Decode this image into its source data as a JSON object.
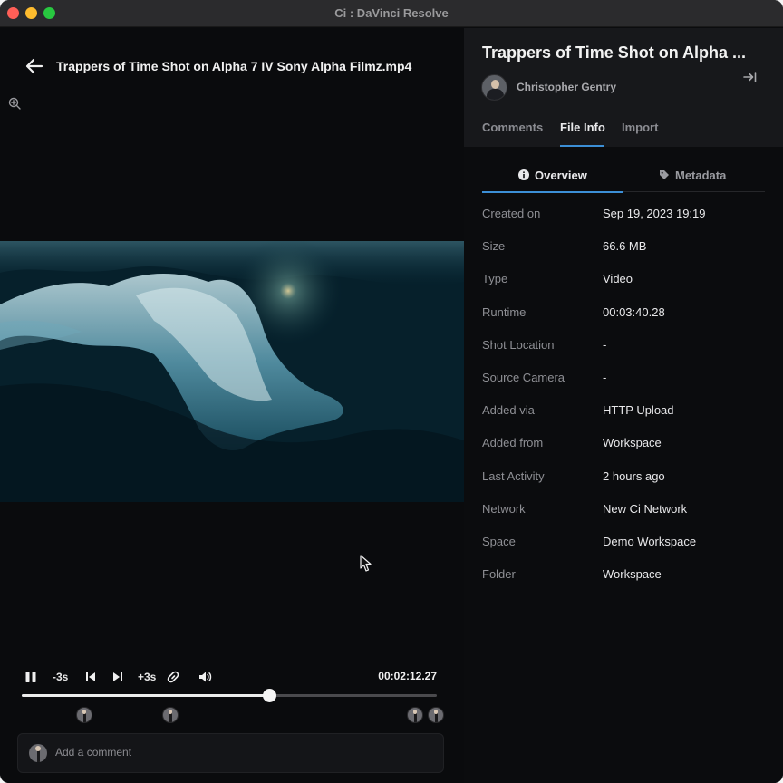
{
  "window": {
    "title": "Ci : DaVinci Resolve"
  },
  "player": {
    "file_title": "Trappers of Time Shot on Alpha 7 IV Sony Alpha Filmz.mp4",
    "controls": {
      "rewind_label": "-3s",
      "forward_label": "+3s",
      "timecode": "00:02:12.27",
      "progress_fraction": 0.595
    },
    "comment_placeholder": "Add a comment"
  },
  "panel": {
    "title": "Trappers of Time Shot on Alpha ...",
    "author": "Christopher Gentry",
    "tabs": [
      {
        "label": "Comments"
      },
      {
        "label": "File Info"
      },
      {
        "label": "Import"
      }
    ],
    "active_tab": "File Info",
    "subtabs": [
      {
        "label": "Overview",
        "icon": "info-icon"
      },
      {
        "label": "Metadata",
        "icon": "tag-icon"
      }
    ],
    "info": [
      {
        "label": "Created on",
        "value": "Sep 19, 2023 19:19"
      },
      {
        "label": "Size",
        "value": "66.6 MB"
      },
      {
        "label": "Type",
        "value": "Video"
      },
      {
        "label": "Runtime",
        "value": "00:03:40.28"
      },
      {
        "label": "Shot Location",
        "value": "-"
      },
      {
        "label": "Source Camera",
        "value": "-"
      },
      {
        "label": "Added via",
        "value": "HTTP Upload"
      },
      {
        "label": "Added from",
        "value": "Workspace"
      },
      {
        "label": "Last Activity",
        "value": "2 hours ago"
      },
      {
        "label": "Network",
        "value": "New Ci Network"
      },
      {
        "label": "Space",
        "value": "Demo Workspace"
      },
      {
        "label": "Folder",
        "value": "Workspace"
      }
    ]
  },
  "colors": {
    "accent": "#3c8fd6",
    "background": "#0b0c0e",
    "panel_header": "#17181b"
  }
}
